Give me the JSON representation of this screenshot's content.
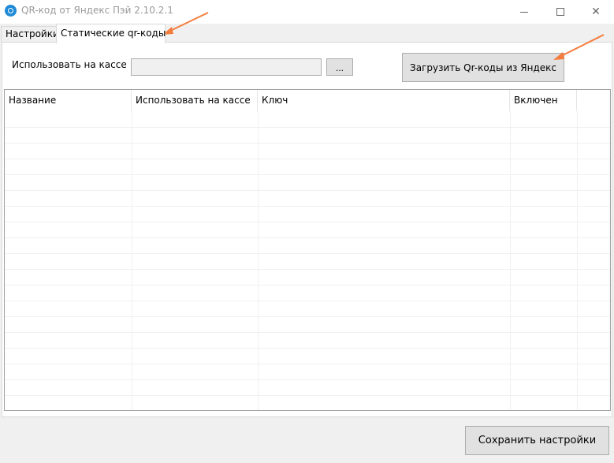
{
  "window": {
    "title": "QR-код от Яндекс Пэй 2.10.2.1",
    "icon": "app-icon"
  },
  "tabs": [
    {
      "label": "Настройки",
      "active": false
    },
    {
      "label": "Статические qr-коды",
      "active": true
    }
  ],
  "form": {
    "use_label": "Использовать на кассе",
    "use_value": "",
    "browse_label": "...",
    "load_button": "Загрузить Qr-коды из Яндекс"
  },
  "grid": {
    "columns": [
      "Название",
      "Использовать на кассе",
      "Ключ",
      "Включен"
    ],
    "rows": []
  },
  "footer": {
    "save_button": "Сохранить настройки"
  },
  "colors": {
    "annotation_arrow": "#f47c3c",
    "app_icon": "#1f8ad6"
  }
}
